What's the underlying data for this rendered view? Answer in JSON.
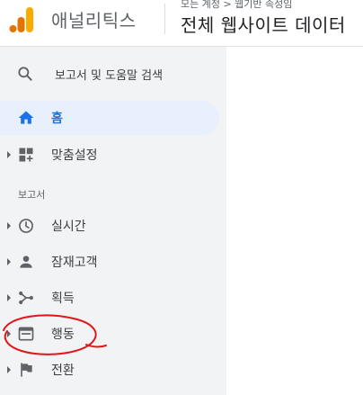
{
  "header": {
    "product_name": "애널리틱스",
    "breadcrumb": "모든 계정 > 웹기반 속성임",
    "property_title": "전체 웹사이트 데이터"
  },
  "search": {
    "label": "보고서 및 도움말 검색",
    "icon": "search-icon"
  },
  "nav": {
    "home": {
      "label": "홈",
      "icon": "home-icon"
    },
    "customization": {
      "label": "맞춤설정",
      "icon": "dashboard-plus-icon"
    },
    "reports_heading": "보고서",
    "realtime": {
      "label": "실시간",
      "icon": "clock-icon"
    },
    "audience": {
      "label": "잠재고객",
      "icon": "person-icon"
    },
    "acquisition": {
      "label": "획득",
      "icon": "acquisition-icon"
    },
    "behavior": {
      "label": "행동",
      "icon": "behavior-icon"
    },
    "conversions": {
      "label": "전환",
      "icon": "flag-icon"
    }
  },
  "colors": {
    "accent": "#1a73e8",
    "active_bg": "#e8f0fe",
    "sidebar_bg": "#f1f3f4",
    "logo_orange": "#f9ab00",
    "logo_dark_orange": "#e37400",
    "annotation_red": "#e0161b"
  }
}
